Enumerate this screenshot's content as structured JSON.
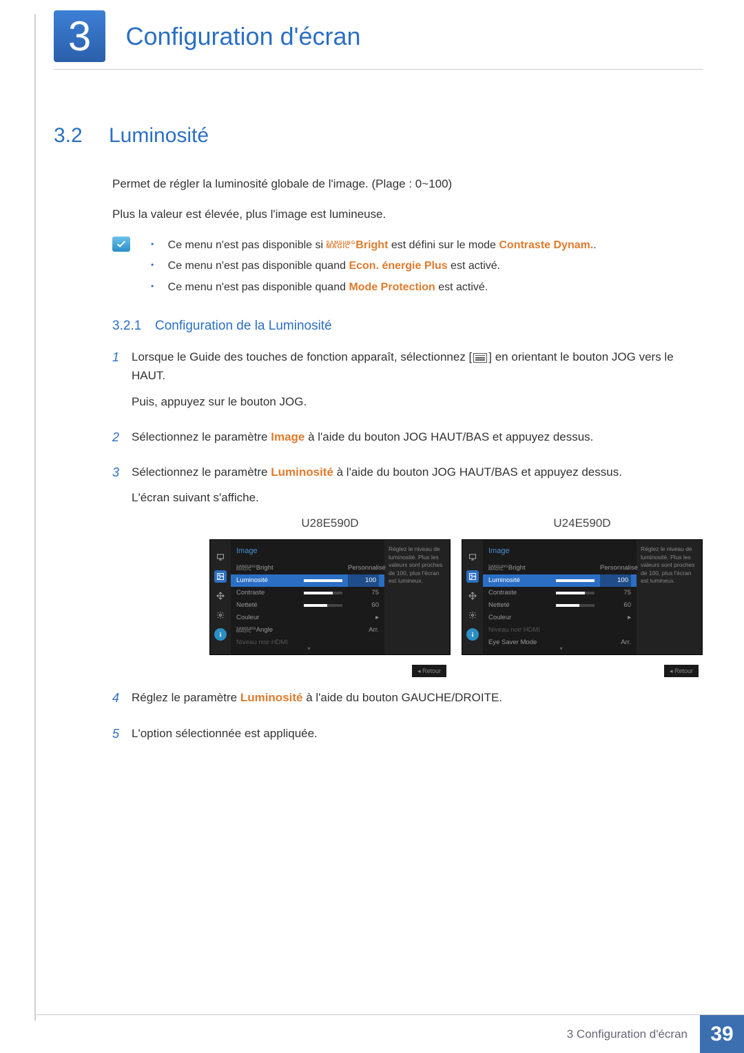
{
  "chapter": {
    "number": "3",
    "title": "Configuration d'écran"
  },
  "section": {
    "number": "3.2",
    "title": "Luminosité"
  },
  "intro": {
    "p1": "Permet de régler la luminosité globale de l'image. (Plage : 0~100)",
    "p2": "Plus la valeur est élevée, plus l'image est lumineuse."
  },
  "notes": {
    "n1_a": "Ce menu n'est pas disponible si ",
    "n1_magic_sup": "SAMSUNG",
    "n1_magic_low": "MAGIC",
    "n1_b": "Bright",
    "n1_c": " est défini sur le mode ",
    "n1_d": "Contraste Dynam.",
    "n1_e": ".",
    "n2_a": "Ce menu n'est pas disponible quand ",
    "n2_b": "Econ. énergie Plus",
    "n2_c": " est activé.",
    "n3_a": "Ce menu n'est pas disponible quand ",
    "n3_b": "Mode Protection",
    "n3_c": " est activé."
  },
  "subsection": {
    "number": "3.2.1",
    "title": "Configuration de la Luminosité"
  },
  "steps": {
    "s1_a": "Lorsque le Guide des touches de fonction apparaît, sélectionnez [",
    "s1_b": "] en orientant le bouton JOG vers le HAUT.",
    "s1_c": "Puis, appuyez sur le bouton JOG.",
    "s2_a": "Sélectionnez le paramètre ",
    "s2_b": "Image",
    "s2_c": " à l'aide du bouton JOG HAUT/BAS et appuyez dessus.",
    "s3_a": "Sélectionnez le paramètre ",
    "s3_b": "Luminosité",
    "s3_c": " à l'aide du bouton JOG HAUT/BAS et appuyez dessus.",
    "s3_d": "L'écran suivant s'affiche.",
    "s4_a": "Réglez le paramètre ",
    "s4_b": "Luminosité",
    "s4_c": " à l'aide du bouton GAUCHE/DROITE.",
    "s5": "L'option sélectionnée est appliquée."
  },
  "step_nums": {
    "n1": "1",
    "n2": "2",
    "n3": "3",
    "n4": "4",
    "n5": "5"
  },
  "osd": {
    "model_left": "U28E590D",
    "model_right": "U24E590D",
    "menu_title": "Image",
    "magic_sup": "SAMSUNG",
    "magic_low": "MAGIC",
    "magic_bright": "Bright",
    "personnalise": "Personnalisé",
    "luminosite": "Luminosité",
    "contraste": "Contraste",
    "nettete": "Netteté",
    "couleur": "Couleur",
    "magic_angle": "Angle",
    "niveau_hdmi": "Niveau noir HDMI",
    "eye_saver": "Eye Saver Mode",
    "arr": "Arr.",
    "val_100": "100",
    "val_75": "75",
    "val_60": "60",
    "arrow": "▸",
    "help_text": "Réglez le niveau de luminosité. Plus les valeurs sont proches de 100, plus l'écran est lumineux.",
    "retour": "Retour",
    "back_arrow": "◂"
  },
  "footer": {
    "text": "3 Configuration d'écran",
    "page": "39"
  }
}
